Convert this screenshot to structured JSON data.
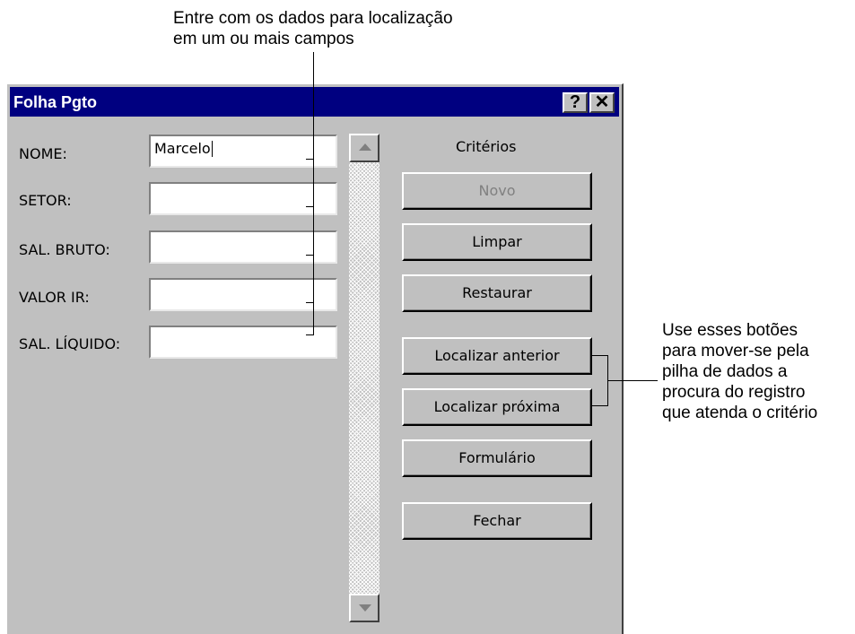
{
  "annotations": {
    "top_line1": "Entre com os dados para localização",
    "top_line2": "em um ou mais campos",
    "right_line1": "Use esses botões",
    "right_line2": "para mover-se pela",
    "right_line3": "pilha de dados a",
    "right_line4": "procura do registro",
    "right_line5": "que atenda o critério"
  },
  "window": {
    "title": "Folha Pgto",
    "help_glyph": "?",
    "close_glyph": "✕"
  },
  "fields": [
    {
      "label": "NOME:",
      "value": "Marcelo"
    },
    {
      "label": "SETOR:",
      "value": ""
    },
    {
      "label": "SAL. BRUTO:",
      "value": ""
    },
    {
      "label": "VALOR IR:",
      "value": ""
    },
    {
      "label": "SAL. LÍQUIDO:",
      "value": ""
    }
  ],
  "criteria_label": "Critérios",
  "buttons": {
    "novo": "Novo",
    "limpar": "Limpar",
    "restaurar": "Restaurar",
    "localizar_anterior": "Localizar anterior",
    "localizar_proxima": "Localizar próxima",
    "formulario": "Formulário",
    "fechar": "Fechar"
  },
  "colors": {
    "titlebar": "#000080",
    "dialog_face": "#c0c0c0",
    "disabled_text": "#808080"
  }
}
